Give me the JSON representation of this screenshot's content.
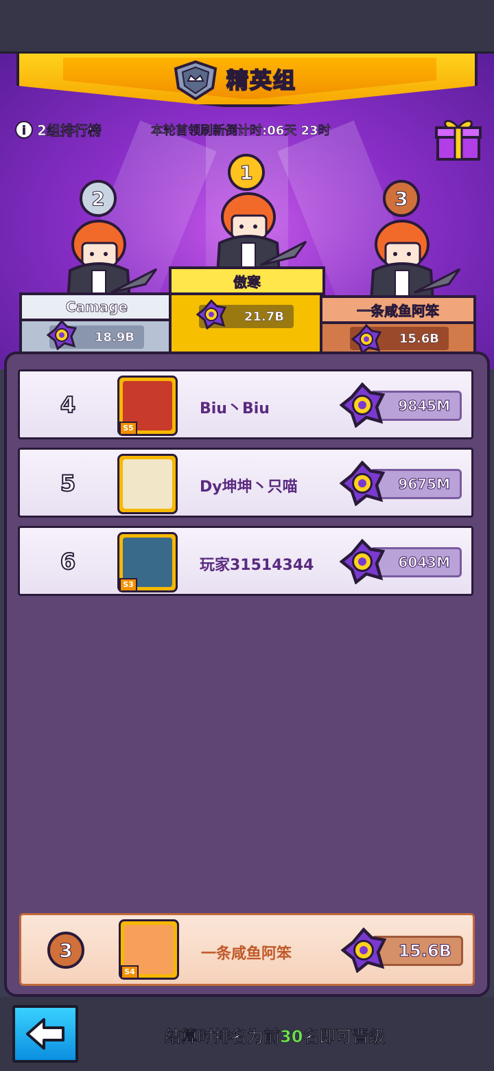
{
  "header": {
    "title": "精英组"
  },
  "info": {
    "group_label": "2组排行榜",
    "countdown": "本轮首领刷新倒计时:06天 23时"
  },
  "podium": [
    {
      "rank": "1",
      "name": "傲寒",
      "score": "21.7B"
    },
    {
      "rank": "2",
      "name": "Camage",
      "score": "18.9B"
    },
    {
      "rank": "3",
      "name": "一条咸鱼阿笨",
      "score": "15.6B"
    }
  ],
  "leaderboard": [
    {
      "rank": "4",
      "name": "Biu丶Biu",
      "score": "9845M",
      "level": "S5"
    },
    {
      "rank": "5",
      "name": "Dy坤坤丶只喵",
      "score": "9675M",
      "level": ""
    },
    {
      "rank": "6",
      "name": "玩家31514344",
      "score": "6043M",
      "level": "S3"
    }
  ],
  "my_entry": {
    "rank": "3",
    "name": "一条咸鱼阿笨",
    "score": "15.6B",
    "level": "S4"
  },
  "footer": {
    "promo_prefix": "结算时排名为前",
    "promo_number": "30",
    "promo_suffix": "名即可晋级"
  },
  "colors": {
    "gold": "#ffd21e",
    "silver": "#dfe6ef",
    "bronze": "#e08a5a",
    "panel": "#5e4573",
    "accent_green": "#6de34a"
  },
  "icons": [
    "info-icon",
    "gift-icon",
    "crown-shield-icon",
    "boss-token-icon",
    "back-arrow-icon"
  ]
}
